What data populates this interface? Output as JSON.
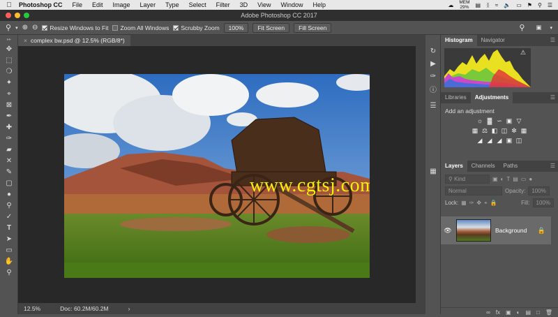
{
  "menubar": {
    "apple_icon": "apple-icon",
    "app_name": "Photoshop CC",
    "items": [
      "File",
      "Edit",
      "Image",
      "Layer",
      "Type",
      "Select",
      "Filter",
      "3D",
      "View",
      "Window",
      "Help"
    ],
    "mem_label": "MEM",
    "mem_value": "29%"
  },
  "window": {
    "title": "Adobe Photoshop CC 2017"
  },
  "options": {
    "resize_windows": "Resize Windows to Fit",
    "zoom_all": "Zoom All Windows",
    "scrubby": "Scrubby Zoom",
    "zoom_pct": "100%",
    "fit_screen": "Fit Screen",
    "fill_screen": "Fill Screen"
  },
  "document": {
    "tab_title": "complex bw.psd @ 12.5% (RGB/8*)",
    "watermark": "www.cgtsj.com"
  },
  "status": {
    "zoom": "12.5%",
    "doc": "Doc: 60.2M/60.2M",
    "arrow": "›"
  },
  "panels": {
    "histogram_tab": "Histogram",
    "navigator_tab": "Navigator",
    "libraries_tab": "Libraries",
    "adjustments_tab": "Adjustments",
    "add_adjustment": "Add an adjustment",
    "layers_tab": "Layers",
    "channels_tab": "Channels",
    "paths_tab": "Paths",
    "kind_placeholder": "Kind",
    "blend_mode": "Normal",
    "opacity_label": "Opacity:",
    "opacity_value": "100%",
    "lock_label": "Lock:",
    "fill_label": "Fill:",
    "fill_value": "100%",
    "layer_name": "Background"
  },
  "colors": {
    "menubar_bg": "#e8e8e8",
    "ui_dark": "#535353",
    "canvas_bg": "#282828",
    "watermark": "#f5f00a",
    "traffic_red": "#ff5f57",
    "traffic_yellow": "#febc2e",
    "traffic_green": "#28c840"
  }
}
